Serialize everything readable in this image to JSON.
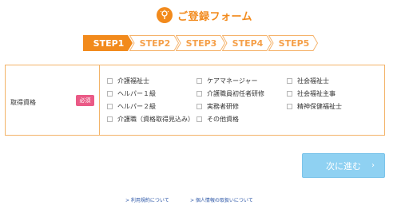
{
  "header": {
    "title": "ご登録フォーム",
    "logo_icon": "bulb-hand-icon",
    "accent_color": "#f28a1c"
  },
  "steps": [
    {
      "label": "STEP1",
      "active": true
    },
    {
      "label": "STEP2",
      "active": false
    },
    {
      "label": "STEP3",
      "active": false
    },
    {
      "label": "STEP4",
      "active": false
    },
    {
      "label": "STEP5",
      "active": false
    }
  ],
  "form": {
    "field_label": "取得資格",
    "required_badge": "必須",
    "required_color": "#ea5a86",
    "options": [
      "介護福祉士",
      "ケアマネージャー",
      "社会福祉士",
      "ヘルパー１級",
      "介護職員初任者研修",
      "社会福祉主事",
      "ヘルパー２級",
      "実務者研修",
      "精神保健福祉士",
      "介護職（資格取得見込み）",
      "その他資格"
    ]
  },
  "next_button": {
    "label": "次に進む",
    "arrow": "›",
    "color": "#8fd1f2"
  },
  "footer": {
    "terms_link": "> 利用規約について",
    "privacy_link": "> 個人情報の取扱いについて"
  }
}
